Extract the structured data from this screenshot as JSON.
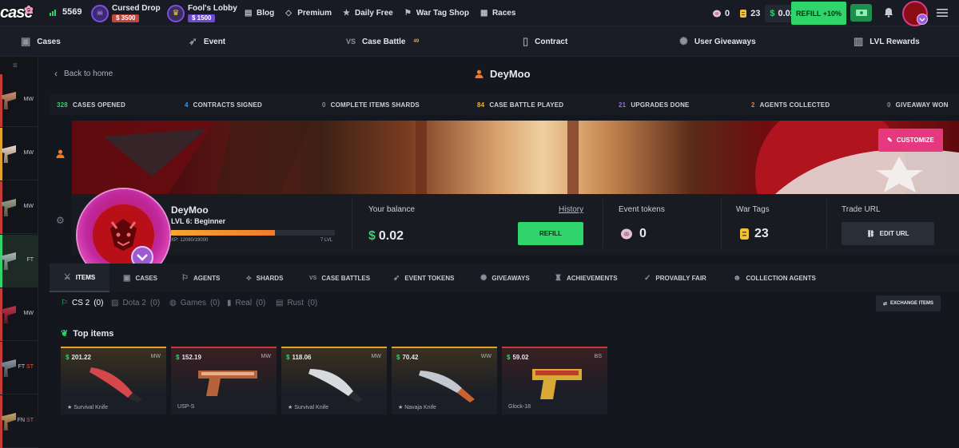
{
  "brand": {
    "logo_text": "case"
  },
  "topbar": {
    "online_count": "5569",
    "lobbies": [
      {
        "name": "Cursed Drop",
        "price": "$ 3500"
      },
      {
        "name": "Fool's Lobby",
        "price": "$ 1500"
      }
    ],
    "nav": [
      {
        "label": "Blog",
        "icon": "book-icon"
      },
      {
        "label": "Premium",
        "icon": "diamond-icon"
      },
      {
        "label": "Daily Free",
        "icon": "star-icon"
      },
      {
        "label": "War Tag Shop",
        "icon": "flag-icon"
      },
      {
        "label": "Races",
        "icon": "checkered-flag-icon"
      }
    ],
    "event_tokens": "0",
    "war_tags": "23",
    "balance": "0.02",
    "refill_label": "REFILL +10%"
  },
  "subnav": [
    {
      "label": "Cases",
      "icon": "briefcase-icon"
    },
    {
      "label": "Event",
      "icon": "rocket-icon"
    },
    {
      "label": "Case Battle",
      "icon": "vs-icon",
      "badge": "49"
    },
    {
      "label": "Contract",
      "icon": "document-icon"
    },
    {
      "label": "User Giveaways",
      "icon": "confetti-icon"
    },
    {
      "label": "LVL Rewards",
      "icon": "bars-icon"
    }
  ],
  "sidebar_feed": [
    {
      "wear": "MW",
      "st": ""
    },
    {
      "wear": "MW",
      "st": ""
    },
    {
      "wear": "MW",
      "st": ""
    },
    {
      "wear": "FT",
      "st": ""
    },
    {
      "wear": "MW",
      "st": ""
    },
    {
      "wear": "FT",
      "st": "ST"
    },
    {
      "wear": "FN",
      "st": "ST"
    }
  ],
  "page": {
    "back_label": "Back to home",
    "username": "DeyMoo"
  },
  "stats": [
    {
      "value": "328",
      "label": "CASES OPENED",
      "color": "#2fd46b"
    },
    {
      "value": "4",
      "label": "CONTRACTS SIGNED",
      "color": "#2da3e8"
    },
    {
      "value": "0",
      "label": "COMPLETE ITEMS SHARDS",
      "color": "#8a8f9c"
    },
    {
      "value": "84",
      "label": "CASE BATTLE PLAYED",
      "color": "#f0b43a"
    },
    {
      "value": "21",
      "label": "UPGRADES DONE",
      "color": "#9a6bf0"
    },
    {
      "value": "2",
      "label": "AGENTS COLLECTED",
      "color": "#f07a2c"
    },
    {
      "value": "0",
      "label": "GIVEAWAY WON",
      "color": "#8a8f9c"
    }
  ],
  "profile": {
    "customize_label": "CUSTOMIZE",
    "name": "DeyMoo",
    "level": "LVL 6: Beginner",
    "xp_text": "XP: 12080/19000",
    "xp_fraction": 0.636,
    "next_level": "7 LVL",
    "balance_label": "Your balance",
    "balance": "0.02",
    "history_label": "History",
    "refill_label": "REFILL",
    "tokens_label": "Event tokens",
    "tokens": "0",
    "war_label": "War Tags",
    "war": "23",
    "trade_label": "Trade URL",
    "edit_url_label": "EDIT URL"
  },
  "tabs": [
    {
      "label": "ITEMS",
      "icon": "knife-icon"
    },
    {
      "label": "CASES",
      "icon": "case-icon"
    },
    {
      "label": "AGENTS",
      "icon": "runner-icon"
    },
    {
      "label": "SHARDS",
      "icon": "shards-icon"
    },
    {
      "label": "CASE BATTLES",
      "icon": "vs-icon"
    },
    {
      "label": "EVENT TOKENS",
      "icon": "rocket-icon"
    },
    {
      "label": "GIVEAWAYS",
      "icon": "confetti-icon"
    },
    {
      "label": "ACHIEVEMENTS",
      "icon": "trophy-icon"
    },
    {
      "label": "PROVABLY FAIR",
      "icon": "thumb-icon"
    },
    {
      "label": "COLLECTION AGENTS",
      "icon": "agent-icon"
    }
  ],
  "games": [
    {
      "label": "CS 2",
      "count": "(0)"
    },
    {
      "label": "Dota 2",
      "count": "(0)"
    },
    {
      "label": "Games",
      "count": "(0)"
    },
    {
      "label": "Real",
      "count": "(0)"
    },
    {
      "label": "Rust",
      "count": "(0)"
    }
  ],
  "exchange_label": "EXCHANGE ITEMS",
  "top_items_title": "Top items",
  "top_items": [
    {
      "price": "201.22",
      "wear": "MW",
      "type": "★ Survival Knife",
      "color": "#e1a329"
    },
    {
      "price": "152.19",
      "wear": "MW",
      "type": "USP-S",
      "color": "#c63a3a"
    },
    {
      "price": "118.06",
      "wear": "MW",
      "type": "★ Survival Knife",
      "color": "#e1a329"
    },
    {
      "price": "70.42",
      "wear": "WW",
      "type": "★ Navaja Knife",
      "color": "#e1a329"
    },
    {
      "price": "59.02",
      "wear": "BS",
      "type": "Glock-18",
      "color": "#c63a3a"
    }
  ]
}
